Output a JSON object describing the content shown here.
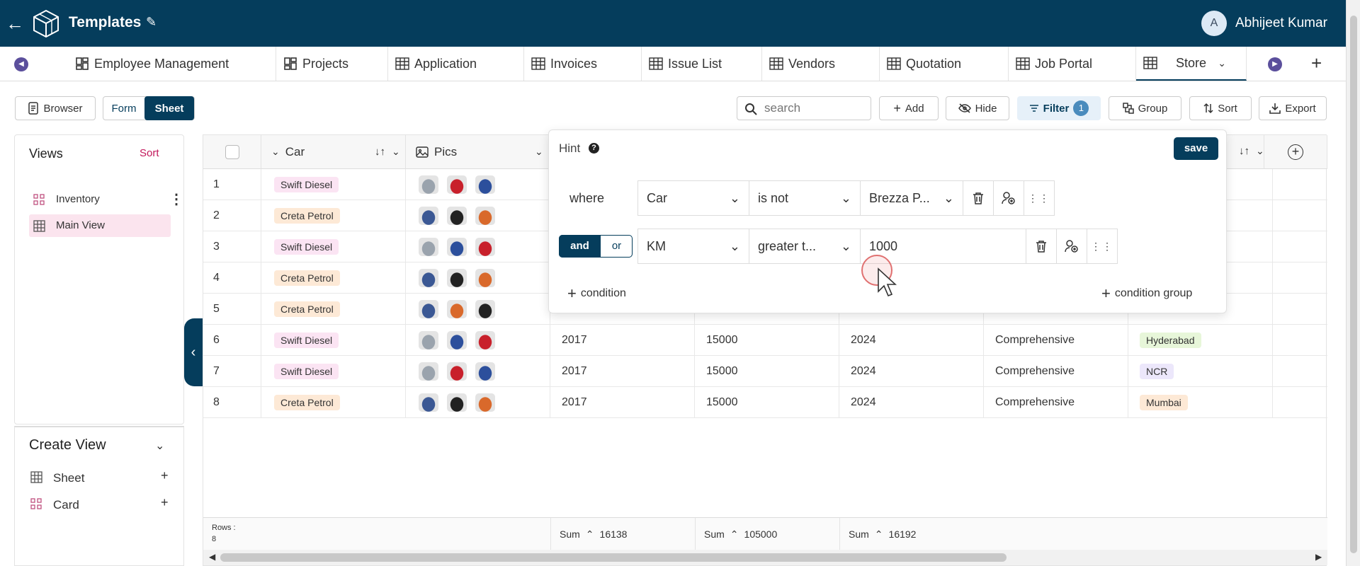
{
  "header": {
    "title": "Templates",
    "user_initial": "A",
    "user_name": "Abhijeet Kumar"
  },
  "tabs": [
    {
      "label": "Employee Management",
      "icon": "dashboard-icon"
    },
    {
      "label": "Projects",
      "icon": "dashboard-icon"
    },
    {
      "label": "Application",
      "icon": "table-icon"
    },
    {
      "label": "Invoices",
      "icon": "table-icon"
    },
    {
      "label": "Issue List",
      "icon": "table-icon"
    },
    {
      "label": "Vendors",
      "icon": "table-icon"
    },
    {
      "label": "Quotation",
      "icon": "table-icon"
    },
    {
      "label": "Job Portal",
      "icon": "table-icon"
    },
    {
      "label": "Store",
      "icon": "table-icon",
      "active": true
    }
  ],
  "toolbar": {
    "browser": "Browser",
    "form": "Form",
    "sheet": "Sheet",
    "search_placeholder": "search",
    "add": "Add",
    "hide": "Hide",
    "filter": "Filter",
    "filter_count": "1",
    "group": "Group",
    "sort": "Sort",
    "export": "Export"
  },
  "sidebar": {
    "views_title": "Views",
    "sort_label": "Sort",
    "views": [
      {
        "label": "Inventory",
        "icon": "card-icon"
      },
      {
        "label": "Main View",
        "icon": "table-icon",
        "selected": true
      }
    ],
    "create_title": "Create View",
    "create_items": [
      {
        "label": "Sheet",
        "icon": "table-icon"
      },
      {
        "label": "Card",
        "icon": "card-icon"
      }
    ]
  },
  "grid": {
    "columns": [
      {
        "label": "Car"
      },
      {
        "label": "Pics"
      }
    ],
    "rows": [
      {
        "n": "1",
        "car": "Swift Diesel",
        "year": "",
        "km": "",
        "y2": "",
        "ins": "",
        "city": ""
      },
      {
        "n": "2",
        "car": "Creta Petrol",
        "year": "",
        "km": "",
        "y2": "",
        "ins": "",
        "city": ""
      },
      {
        "n": "3",
        "car": "Swift Diesel",
        "year": "",
        "km": "",
        "y2": "",
        "ins": "",
        "city": ""
      },
      {
        "n": "4",
        "car": "Creta Petrol",
        "year": "",
        "km": "",
        "y2": "",
        "ins": "",
        "city": ""
      },
      {
        "n": "5",
        "car": "Creta Petrol",
        "year": "",
        "km": "",
        "y2": "",
        "ins": "",
        "city": ""
      },
      {
        "n": "6",
        "car": "Swift Diesel",
        "year": "2017",
        "km": "15000",
        "y2": "2024",
        "ins": "Comprehensive",
        "city": "Hyderabad"
      },
      {
        "n": "7",
        "car": "Swift Diesel",
        "year": "2017",
        "km": "15000",
        "y2": "2024",
        "ins": "Comprehensive",
        "city": "NCR"
      },
      {
        "n": "8",
        "car": "Creta Petrol",
        "year": "2017",
        "km": "15000",
        "y2": "2024",
        "ins": "Comprehensive",
        "city": "Mumbai"
      }
    ],
    "footer": {
      "rows_label": "Rows :",
      "rows_count": "8",
      "sum_label": "Sum",
      "sums": [
        "16138",
        "105000",
        "16192"
      ]
    }
  },
  "filter": {
    "hint": "Hint",
    "save": "save",
    "conditions": [
      {
        "prefix": "where",
        "field": "Car",
        "op": "is not",
        "value": "Brezza P..."
      },
      {
        "field": "KM",
        "op": "greater t...",
        "value": "1000"
      }
    ],
    "and": "and",
    "or": "or",
    "add_condition": "condition",
    "add_group": "condition group"
  },
  "colors": {
    "primary": "#053d5c",
    "accent": "#5b4f9c",
    "filter_bg": "#e6f0f9",
    "sort_pink": "#c2185b"
  }
}
